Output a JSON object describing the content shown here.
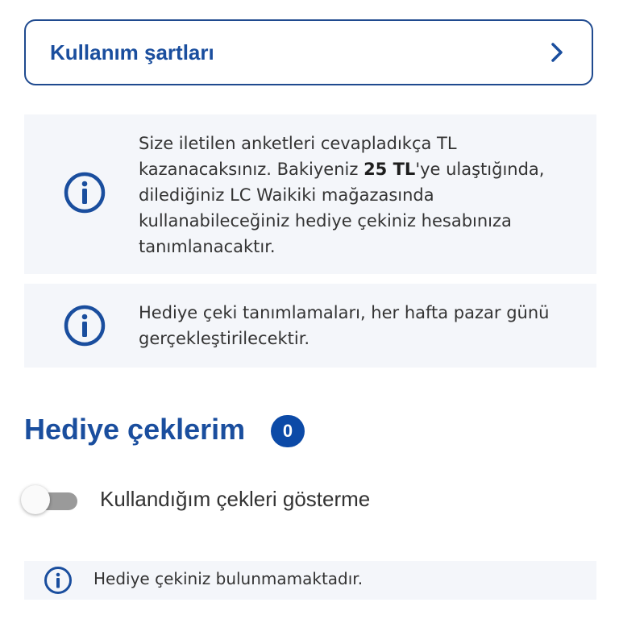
{
  "terms": {
    "label": "Kullanım şartları",
    "chevron_icon": "chevron-right-icon"
  },
  "info_survey": {
    "icon": "info-icon",
    "text_before": "Size iletilen anketleri cevapladıkça TL kazanacaksınız. Bakiyeniz ",
    "highlight": "25 TL",
    "text_after": "'ye ulaştığında, dilediğiniz LC Waikiki mağazasında kullanabileceğiniz hediye çekiniz hesabınıza tanımlanacaktır."
  },
  "info_schedule": {
    "icon": "info-icon",
    "text": "Hediye çeki tanımlamaları, her hafta pazar günü gerçekleştirilecektir."
  },
  "gift_cards": {
    "title": "Hediye çeklerim",
    "count": "0"
  },
  "toggle": {
    "label": "Kullandığım çekleri gösterme",
    "checked": false
  },
  "empty_state": {
    "icon": "info-icon",
    "text": "Hediye çekiniz bulunmamaktadır."
  },
  "colors": {
    "brand_blue": "#1a4e9e",
    "badge_blue": "#0c4aa7",
    "info_bg": "#f4f6fa"
  }
}
